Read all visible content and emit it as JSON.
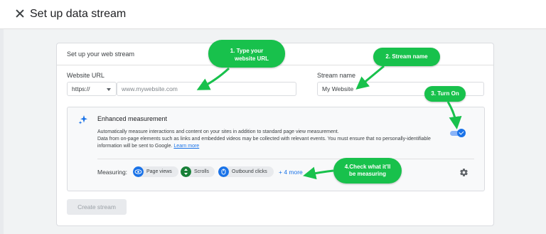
{
  "header": {
    "title": "Set up data stream"
  },
  "card": {
    "heading": "Set up your web stream",
    "website_url_label": "Website URL",
    "protocol_value": "https://",
    "url_placeholder": "www.mywebsite.com",
    "stream_name_label": "Stream name",
    "stream_name_value": "My Website"
  },
  "enhanced": {
    "title": "Enhanced measurement",
    "desc_line1": "Automatically measure interactions and content on your sites in addition to standard page view measurement.",
    "desc_line2": "Data from on-page elements such as links and embedded videos may be collected with relevant events. You must ensure that no personally-identifiable information will be sent to Google.",
    "learn_more": "Learn more",
    "toggle_on": true,
    "measuring_label": "Measuring:",
    "chips": [
      "Page views",
      "Scrolls",
      "Outbound clicks"
    ],
    "more_label": "+ 4 more"
  },
  "create_button": "Create stream",
  "annotations": {
    "step1_line1": "1.  Type your",
    "step1_line2": "website URL",
    "step2": "2. Stream name",
    "step3": "3. Turn On",
    "step4_line1": "4.Check what it'll",
    "step4_line2": "be measuring"
  },
  "colors": {
    "accent": "#1a73e8",
    "annotation": "#18c14c",
    "chip_icon": "#1a73e8"
  },
  "icons": [
    "close-icon",
    "sparkle-icon",
    "eye-icon",
    "scroll-icon",
    "outbound-icon",
    "gear-icon",
    "chevron-down-icon"
  ]
}
